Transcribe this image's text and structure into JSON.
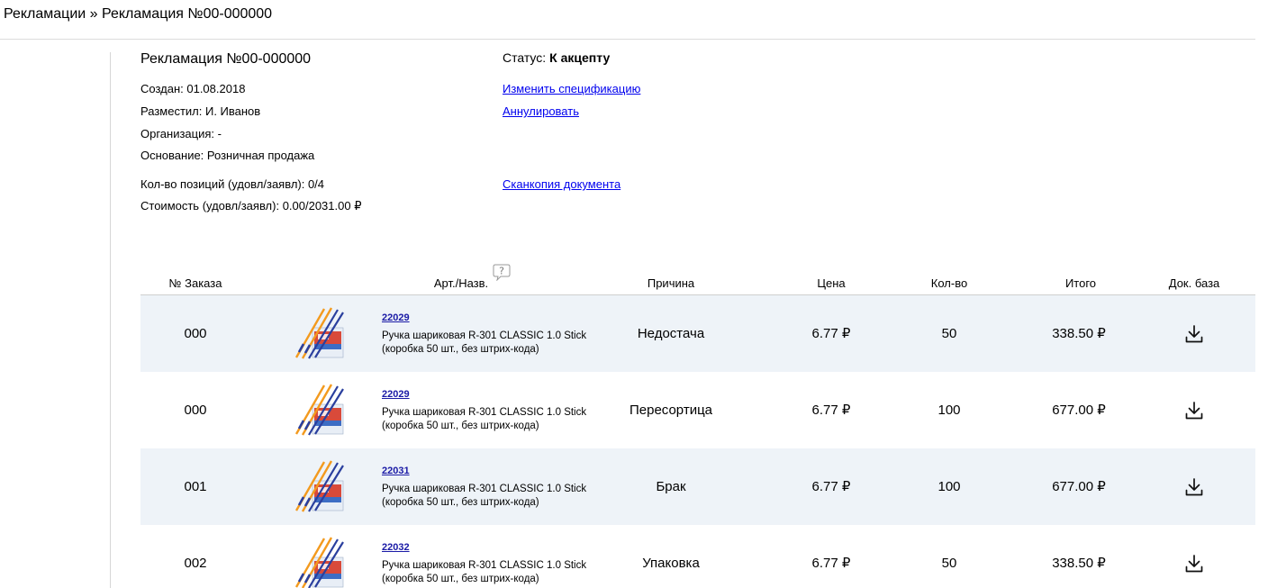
{
  "breadcrumb": {
    "text": "Рекламации » Рекламация №00-000000"
  },
  "claim": {
    "title": "Рекламация №00-000000",
    "created": "Создан: 01.08.2018",
    "placed_by": "Разместил: И. Иванов",
    "organization": "Организация: -",
    "basis": "Основание: Розничная продажа",
    "positions": "Кол-во позиций (удовл/заявл): 0/4",
    "cost": "Стоимость (удовл/заявл): 0.00/2031.00 ₽"
  },
  "status": {
    "label": "Статус:",
    "value": "К акцепту"
  },
  "actions": {
    "change_spec": "Изменить спецификацию",
    "cancel": "Аннулировать",
    "scan_copy": "Сканкопия документа"
  },
  "table": {
    "headers": {
      "order": "№ Заказа",
      "article": "Арт./Назв.",
      "reason": "Причина",
      "price": "Цена",
      "qty": "Кол-во",
      "total": "Итого",
      "docs": "Док. база"
    },
    "help_icon": "question-bubble-icon",
    "rows": [
      {
        "order": "000",
        "code": "22029",
        "name1": "Ручка шариковая R-301 CLASSIC 1.0 Stick",
        "name2": "(коробка 50 шт., без штрих-кода)",
        "reason": "Недостача",
        "price": "6.77 ₽",
        "qty": "50",
        "total": "338.50 ₽"
      },
      {
        "order": "000",
        "code": "22029",
        "name1": "Ручка шариковая R-301 CLASSIC 1.0 Stick",
        "name2": "(коробка 50 шт., без штрих-кода)",
        "reason": "Пересортица",
        "price": "6.77 ₽",
        "qty": "100",
        "total": "677.00 ₽"
      },
      {
        "order": "001",
        "code": "22031",
        "name1": "Ручка шариковая R-301 CLASSIC 1.0 Stick",
        "name2": "(коробка 50 шт., без штрих-кода)",
        "reason": "Брак",
        "price": "6.77 ₽",
        "qty": "100",
        "total": "677.00 ₽"
      },
      {
        "order": "002",
        "code": "22032",
        "name1": "Ручка шариковая R-301 CLASSIC 1.0 Stick",
        "name2": "(коробка 50 шт., без штрих-кода)",
        "reason": "Упаковка",
        "price": "6.77 ₽",
        "qty": "50",
        "total": "338.50 ₽"
      }
    ]
  },
  "colors": {
    "link": "#0000ee",
    "row_shade": "#eef3f8",
    "pen_orange": "#f39a1e",
    "pen_blue": "#2a3f9e"
  }
}
